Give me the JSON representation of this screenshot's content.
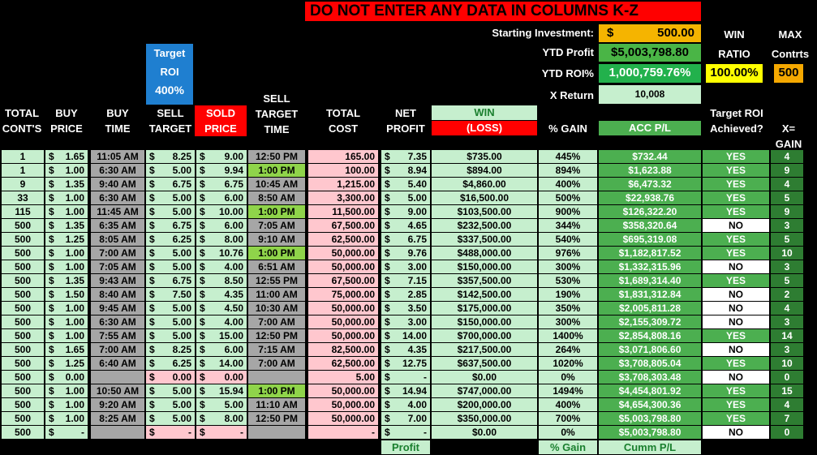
{
  "banner": "DO NOT ENTER ANY DATA IN COLUMNS K-Z",
  "summary": {
    "starting_investment_label": "Starting Investment:",
    "starting_investment_currency": "$",
    "starting_investment_value": "500.00",
    "ytd_profit_label": "YTD Profit",
    "ytd_profit_value": "$5,003,798.80",
    "ytd_roi_label": "YTD ROI%",
    "ytd_roi_value": "1,000,759.76%",
    "x_return_label": "X Return",
    "x_return_value": "10,008",
    "win_label": "WIN",
    "ratio_label": "RATIO",
    "win_ratio_value": "100.00%",
    "max_label": "MAX",
    "contrts_label": "Contrts",
    "max_contracts_value": "500"
  },
  "target_roi": {
    "line1": "Target",
    "line2": "ROI",
    "value": "400%"
  },
  "headers": {
    "total": "TOTAL",
    "conts": "CONT'S",
    "buy1": "BUY",
    "price1": "PRICE",
    "buy2": "BUY",
    "time1": "TIME",
    "sell1": "SELL",
    "target1": "TARGET",
    "sold": "SOLD",
    "price2": "PRICE",
    "sell2": "SELL",
    "target2": "TARGET",
    "time2": "TIME",
    "total2": "TOTAL",
    "cost": "COST",
    "net": "NET",
    "profit": "PROFIT",
    "win": "WIN",
    "loss": "(LOSS)",
    "gain": "% GAIN",
    "acc": "ACC P/L",
    "target_roi_q1": "Target ROI",
    "target_roi_q2": "Achieved?",
    "x1": "X=",
    "x2": "GAIN"
  },
  "rows": [
    [
      "1",
      "$",
      "1.65",
      "11:05 AM",
      "$",
      "8.25",
      "$",
      "9.00",
      "12:50 PM",
      "165.00",
      "$",
      "7.35",
      "$735.00",
      "445%",
      "$732.44",
      "YES",
      "4"
    ],
    [
      "1",
      "$",
      "1.00",
      "6:30 AM",
      "$",
      "5.00",
      "$",
      "9.94",
      "1:00 PM",
      "100.00",
      "$",
      "8.94",
      "$894.00",
      "894%",
      "$1,623.88",
      "YES",
      "9"
    ],
    [
      "9",
      "$",
      "1.35",
      "9:40 AM",
      "$",
      "6.75",
      "$",
      "6.75",
      "10:45 AM",
      "1,215.00",
      "$",
      "5.40",
      "$4,860.00",
      "400%",
      "$6,473.32",
      "YES",
      "4"
    ],
    [
      "33",
      "$",
      "1.00",
      "6:30 AM",
      "$",
      "5.00",
      "$",
      "6.00",
      "8:50 AM",
      "3,300.00",
      "$",
      "5.00",
      "$16,500.00",
      "500%",
      "$22,938.76",
      "YES",
      "5"
    ],
    [
      "115",
      "$",
      "1.00",
      "11:45 AM",
      "$",
      "5.00",
      "$",
      "10.00",
      "1:00 PM",
      "11,500.00",
      "$",
      "9.00",
      "$103,500.00",
      "900%",
      "$126,322.20",
      "YES",
      "9"
    ],
    [
      "500",
      "$",
      "1.35",
      "6:35 AM",
      "$",
      "6.75",
      "$",
      "6.00",
      "7:05 AM",
      "67,500.00",
      "$",
      "4.65",
      "$232,500.00",
      "344%",
      "$358,320.64",
      "NO",
      "3"
    ],
    [
      "500",
      "$",
      "1.25",
      "8:05 AM",
      "$",
      "6.25",
      "$",
      "8.00",
      "9:10 AM",
      "62,500.00",
      "$",
      "6.75",
      "$337,500.00",
      "540%",
      "$695,319.08",
      "YES",
      "5"
    ],
    [
      "500",
      "$",
      "1.00",
      "7:00 AM",
      "$",
      "5.00",
      "$",
      "10.76",
      "1:00 PM",
      "50,000.00",
      "$",
      "9.76",
      "$488,000.00",
      "976%",
      "$1,182,817.52",
      "YES",
      "10"
    ],
    [
      "500",
      "$",
      "1.00",
      "7:05 AM",
      "$",
      "5.00",
      "$",
      "4.00",
      "6:51 AM",
      "50,000.00",
      "$",
      "3.00",
      "$150,000.00",
      "300%",
      "$1,332,315.96",
      "NO",
      "3"
    ],
    [
      "500",
      "$",
      "1.35",
      "9:43 AM",
      "$",
      "6.75",
      "$",
      "8.50",
      "12:55 PM",
      "67,500.00",
      "$",
      "7.15",
      "$357,500.00",
      "530%",
      "$1,689,314.40",
      "YES",
      "5"
    ],
    [
      "500",
      "$",
      "1.50",
      "8:40 AM",
      "$",
      "7.50",
      "$",
      "4.35",
      "11:00 AM",
      "75,000.00",
      "$",
      "2.85",
      "$142,500.00",
      "190%",
      "$1,831,312.84",
      "NO",
      "2"
    ],
    [
      "500",
      "$",
      "1.00",
      "9:45 AM",
      "$",
      "5.00",
      "$",
      "4.50",
      "10:30 AM",
      "50,000.00",
      "$",
      "3.50",
      "$175,000.00",
      "350%",
      "$2,005,811.28",
      "NO",
      "4"
    ],
    [
      "500",
      "$",
      "1.00",
      "6:30 AM",
      "$",
      "5.00",
      "$",
      "4.00",
      "7:00 AM",
      "50,000.00",
      "$",
      "3.00",
      "$150,000.00",
      "300%",
      "$2,155,309.72",
      "NO",
      "3"
    ],
    [
      "500",
      "$",
      "1.00",
      "7:55 AM",
      "$",
      "5.00",
      "$",
      "15.00",
      "12:50 PM",
      "50,000.00",
      "$",
      "14.00",
      "$700,000.00",
      "1400%",
      "$2,854,808.16",
      "YES",
      "14"
    ],
    [
      "500",
      "$",
      "1.65",
      "7:00 AM",
      "$",
      "8.25",
      "$",
      "6.00",
      "7:15 AM",
      "82,500.00",
      "$",
      "4.35",
      "$217,500.00",
      "264%",
      "$3,071,806.60",
      "NO",
      "3"
    ],
    [
      "500",
      "$",
      "1.25",
      "6:40 AM",
      "$",
      "6.25",
      "$",
      "14.00",
      "7:00 AM",
      "62,500.00",
      "$",
      "12.75",
      "$637,500.00",
      "1020%",
      "$3,708,805.04",
      "YES",
      "10"
    ],
    [
      "500",
      "$",
      "0.00",
      "",
      "$",
      "0.00",
      "$",
      "0.00",
      "",
      "5.00",
      "$",
      "-",
      "$0.00",
      "0%",
      "$3,708,303.48",
      "NO",
      "0"
    ],
    [
      "500",
      "$",
      "1.00",
      "10:50 AM",
      "$",
      "5.00",
      "$",
      "15.94",
      "1:00 PM",
      "50,000.00",
      "$",
      "14.94",
      "$747,000.00",
      "1494%",
      "$4,454,801.92",
      "YES",
      "15"
    ],
    [
      "500",
      "$",
      "1.00",
      "9:20 AM",
      "$",
      "5.00",
      "$",
      "5.00",
      "11:10 AM",
      "50,000.00",
      "$",
      "4.00",
      "$200,000.00",
      "400%",
      "$4,654,300.36",
      "YES",
      "4"
    ],
    [
      "500",
      "$",
      "1.00",
      "8:25 AM",
      "$",
      "5.00",
      "$",
      "8.00",
      "12:50 PM",
      "50,000.00",
      "$",
      "7.00",
      "$350,000.00",
      "700%",
      "$5,003,798.80",
      "YES",
      "7"
    ],
    [
      "500",
      "$",
      "-",
      "",
      "$",
      "-",
      "$",
      "-",
      "",
      "-",
      "$",
      "-",
      "$0.00",
      "0%",
      "$5,003,798.80",
      "NO",
      "0"
    ]
  ],
  "footer": {
    "profit": "Profit",
    "gain": "% Gain",
    "cumm": "Cumm P/L"
  },
  "colors": {
    "banner_red": "#ff0000",
    "starting_gold": "#f5b400",
    "ytd_green": "#4ab546",
    "roi_green": "#22b14c",
    "win_yellow": "#ffff00",
    "max_orange": "#f5a800",
    "target_blue": "#1f7fd0",
    "sold_red": "#ff0000",
    "light_green": "#c6efce",
    "dark_green": "#4caf50",
    "pink": "#ffc7ce",
    "grey": "#a6a6a6",
    "lime": "#8fd44a",
    "x_gain_green": "#2e7d32"
  }
}
